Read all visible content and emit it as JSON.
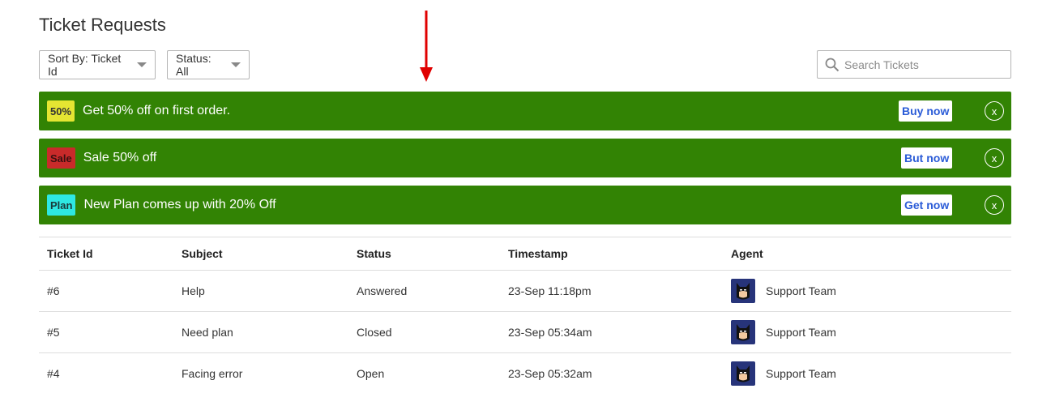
{
  "page_title": "Ticket Requests",
  "filters": {
    "sort_label": "Sort By: Ticket Id",
    "status_label": "Status: All"
  },
  "search": {
    "placeholder": "Search Tickets",
    "value": ""
  },
  "banners": [
    {
      "badge": "50%",
      "text": "Get 50% off on first order.",
      "cta": "Buy now",
      "close": "x"
    },
    {
      "badge": "Sale",
      "text": "Sale 50% off",
      "cta": "But now",
      "close": "x"
    },
    {
      "badge": "Plan",
      "text": "New Plan comes up with 20% Off",
      "cta": "Get now",
      "close": "x"
    }
  ],
  "table": {
    "headers": [
      "Ticket Id",
      "Subject",
      "Status",
      "Timestamp",
      "Agent"
    ],
    "rows": [
      {
        "id": "#6",
        "subject": "Help",
        "status": "Answered",
        "timestamp": "23-Sep 11:18pm",
        "agent": "Support Team"
      },
      {
        "id": "#5",
        "subject": "Need plan",
        "status": "Closed",
        "timestamp": "23-Sep 05:34am",
        "agent": "Support Team"
      },
      {
        "id": "#4",
        "subject": "Facing error",
        "status": "Open",
        "timestamp": "23-Sep 05:32am",
        "agent": "Support Team"
      }
    ]
  },
  "colors": {
    "banner_bg": "#328304",
    "badge_50": "#e5e532",
    "badge_sale": "#c92a2a",
    "badge_plan": "#2ee8e3",
    "cta_text": "#2a5bd7",
    "annotation_arrow": "#e00000"
  },
  "icons": {
    "search": "search-icon",
    "caret": "caret-down-icon",
    "close": "close-icon",
    "avatar": "batman-avatar-icon",
    "arrow": "down-arrow-icon"
  }
}
